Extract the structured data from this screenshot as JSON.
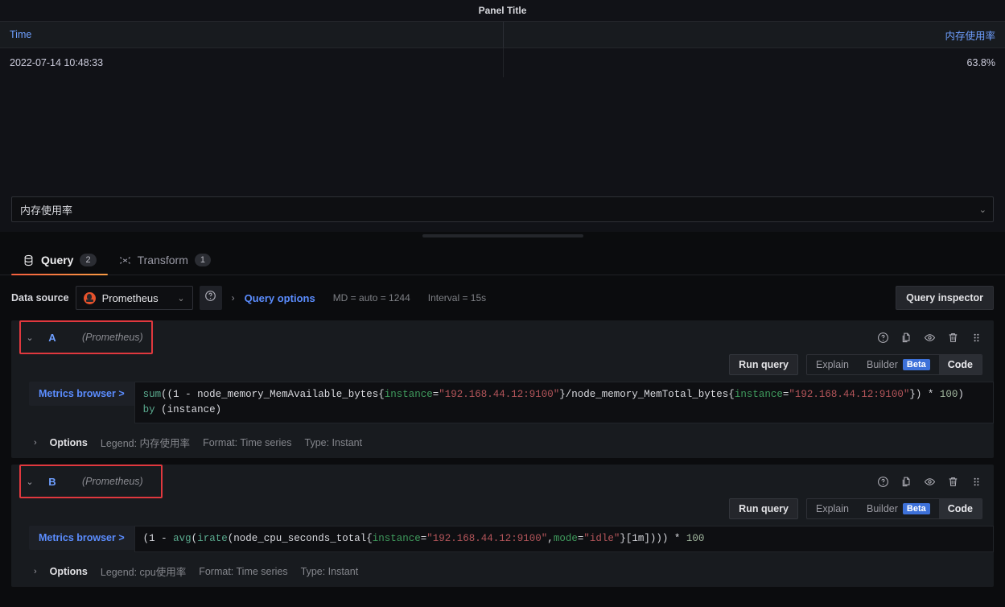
{
  "panel": {
    "title": "Panel Title",
    "table": {
      "columns": [
        "Time",
        "内存使用率"
      ],
      "rows": [
        [
          "2022-07-14 10:48:33",
          "63.8%"
        ]
      ]
    }
  },
  "viz_picker": {
    "selected": "内存使用率",
    "chevron": "⌄"
  },
  "tabs": [
    {
      "label": "Query",
      "badge": "2",
      "icon": "database-icon",
      "active": true
    },
    {
      "label": "Transform",
      "badge": "1",
      "icon": "transform-icon",
      "active": false
    }
  ],
  "datasource_row": {
    "label": "Data source",
    "name": "Prometheus",
    "chevron": "⌄",
    "help_icon": "help-circle-icon",
    "expand_arrow": "›",
    "query_options_link": "Query options",
    "max_data_points": "MD = auto = 1244",
    "interval": "Interval = 15s",
    "query_inspector": "Query inspector"
  },
  "queries": [
    {
      "ref": "A",
      "datasource": "(Prometheus)",
      "collapse_chevron": "⌄",
      "run_query": "Run query",
      "explain": "Explain",
      "builder": "Builder",
      "beta": "Beta",
      "code": "Code",
      "mode": "Code",
      "metrics_browser": "Metrics browser >",
      "expression": "sum((1 - node_memory_MemAvailable_bytes{instance=\"192.168.44.12:9100\"}/node_memory_MemTotal_bytes{instance=\"192.168.44.12:9100\"}) * 100) by (instance)",
      "options": {
        "title": "Options",
        "chevron": "›",
        "legend": "Legend: 内存使用率",
        "format": "Format: Time series",
        "type": "Type: Instant"
      },
      "actions": [
        "help-circle-icon",
        "duplicate-icon",
        "eye-icon",
        "trash-icon",
        "drag-handle-icon"
      ]
    },
    {
      "ref": "B",
      "datasource": "(Prometheus)",
      "collapse_chevron": "⌄",
      "run_query": "Run query",
      "explain": "Explain",
      "builder": "Builder",
      "beta": "Beta",
      "code": "Code",
      "mode": "Code",
      "metrics_browser": "Metrics browser >",
      "expression": "(1 - avg(irate(node_cpu_seconds_total{instance=\"192.168.44.12:9100\",mode=\"idle\"}[1m]))) * 100",
      "options": {
        "title": "Options",
        "chevron": "›",
        "legend": "Legend: cpu使用率",
        "format": "Format: Time series",
        "type": "Type: Instant"
      },
      "actions": [
        "help-circle-icon",
        "duplicate-icon",
        "eye-icon",
        "trash-icon",
        "drag-handle-icon"
      ]
    }
  ],
  "colors": {
    "accent_orange": "#f55f3e",
    "link_blue": "#6e9fff",
    "highlight_red": "#e0383e",
    "beta_blue": "#3d71d9",
    "panel_bg": "#111217",
    "app_bg": "#0b0c0e"
  }
}
